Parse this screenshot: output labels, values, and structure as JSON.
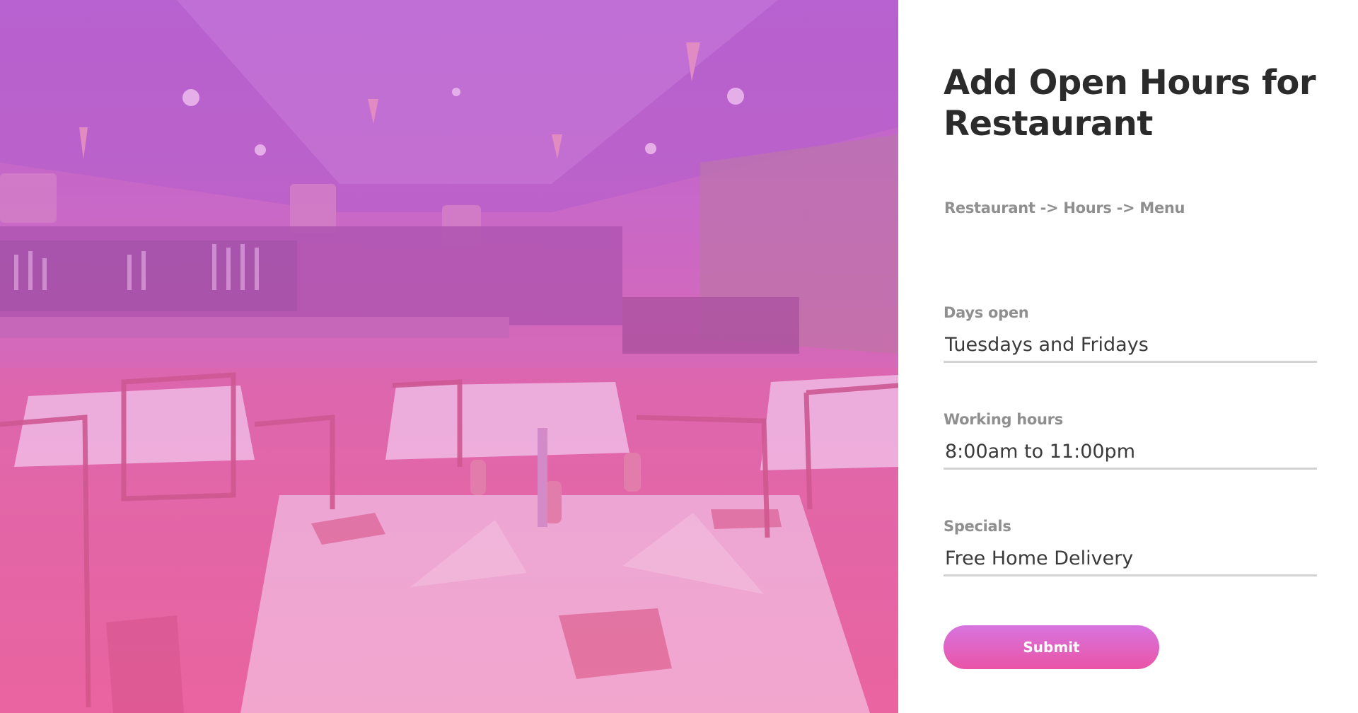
{
  "form": {
    "title": "Add Open Hours for Restaurant",
    "breadcrumb": "Restaurant -> Hours -> Menu",
    "fields": [
      {
        "label": "Days open",
        "value": "Tuesdays and Fridays"
      },
      {
        "label": "Working hours",
        "value": "8:00am to 11:00pm"
      },
      {
        "label": "Specials",
        "value": "Free Home Delivery"
      }
    ],
    "submit_label": "Submit"
  },
  "colors": {
    "title": "#2b2b2b",
    "label": "#8f8f8f",
    "input_text": "#3a3a3a",
    "underline": "#d3d3d3",
    "button_top": "#d774e0",
    "button_bottom": "#ea54a6",
    "hero_top": "#b565c9",
    "hero_bottom": "#e967a0"
  },
  "hero": {
    "image": "restaurant-dining-room-photo"
  }
}
